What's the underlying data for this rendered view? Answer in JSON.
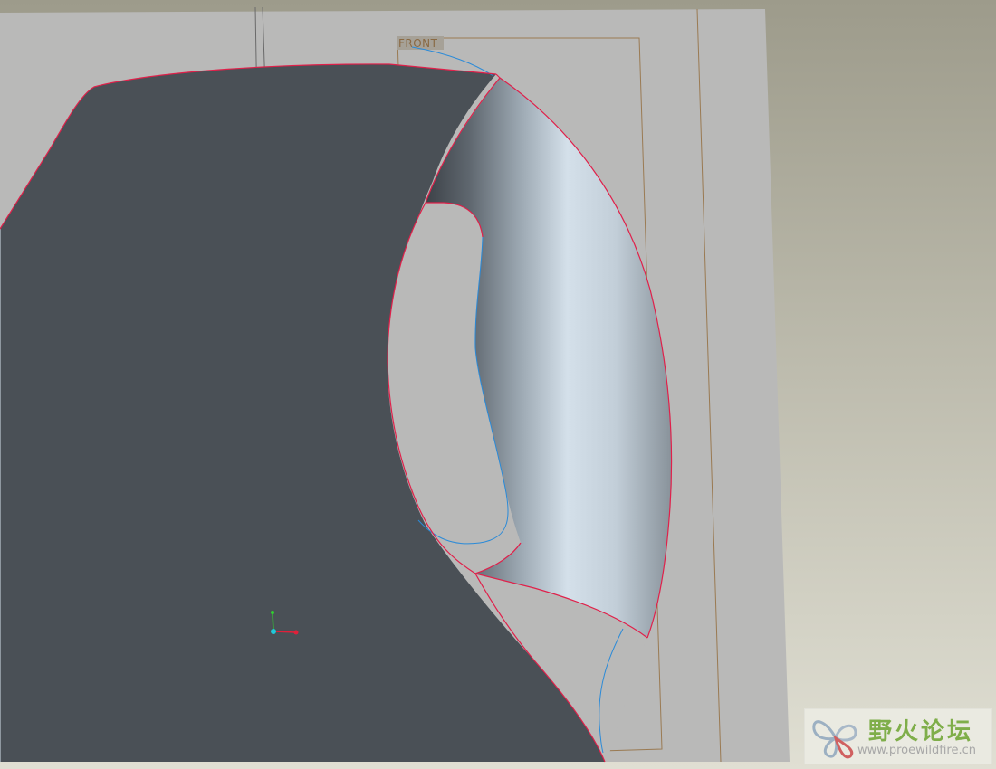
{
  "viewport": {
    "datum_plane_label": "FRONT",
    "background_top_color": "#9d9b8b",
    "background_bottom_color": "#e0dfd3",
    "plane_fill_color": "#b9b9b8",
    "surface_edge_color": "#e0204a",
    "datum_plane_color": "#9a7a52",
    "sketch_curve_color": "#2a8ad8"
  },
  "model": {
    "object": "pitcher-with-handle",
    "render_mode": "shaded-with-edges"
  },
  "coordinate_system": {
    "x_axis_color": "#e0203a",
    "y_axis_color": "#30d030",
    "origin_color": "#20c8d8"
  },
  "watermark": {
    "title": "野火论坛",
    "url": "www.proewildfire.cn"
  }
}
